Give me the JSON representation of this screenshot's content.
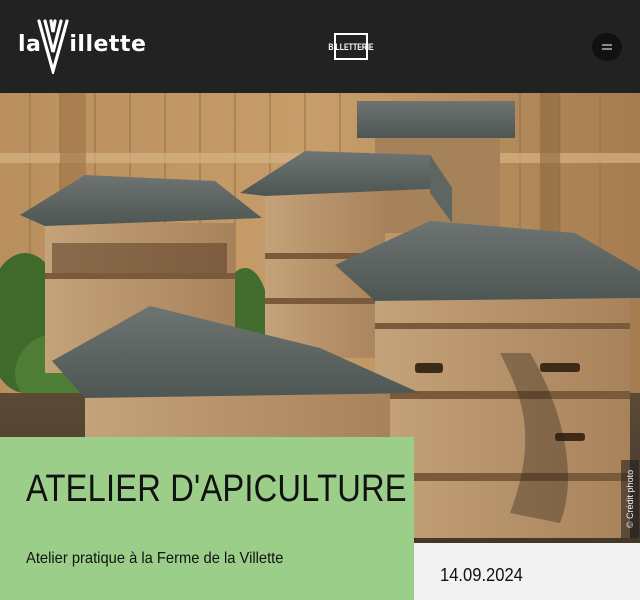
{
  "header": {
    "logo_text": "laVillette",
    "ticket_label": "BILLETTERIE",
    "menu_icon": "hamburger-icon"
  },
  "event": {
    "title": "ATELIER D'APICULTURE",
    "subtitle": "Atelier pratique à la Ferme de la Villette",
    "date": "14.09.2024"
  },
  "photo": {
    "credit": "© Crédit photo"
  },
  "colors": {
    "header_bg": "#222222",
    "title_bg": "#9bcf89",
    "date_bg": "#f2f2f2"
  }
}
